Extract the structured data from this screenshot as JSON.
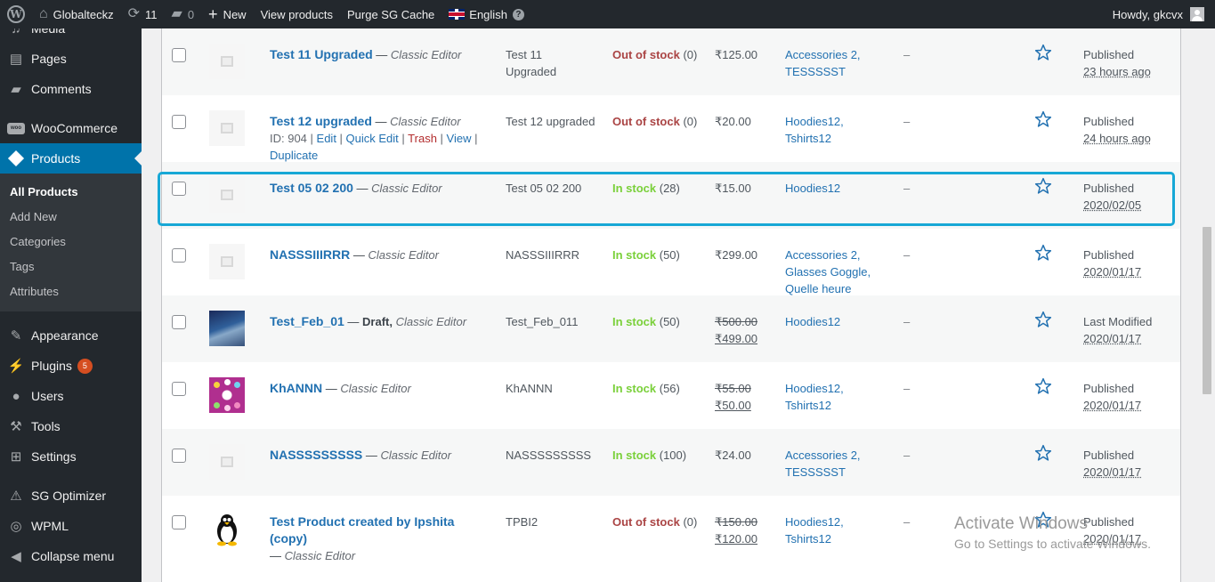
{
  "adminbar": {
    "site_name": "Globalteckz",
    "updates_count": "11",
    "comments_count": "0",
    "new_label": "New",
    "view_products": "View products",
    "purge_cache": "Purge SG Cache",
    "language": "English",
    "howdy": "Howdy, gkcvx"
  },
  "sidebar": {
    "media": "Media",
    "pages": "Pages",
    "comments": "Comments",
    "woocommerce": "WooCommerce",
    "woo_icon_text": "woo",
    "products": "Products",
    "submenu": [
      "All Products",
      "Add New",
      "Categories",
      "Tags",
      "Attributes"
    ],
    "appearance": "Appearance",
    "plugins": "Plugins",
    "plugins_badge": "5",
    "users": "Users",
    "tools": "Tools",
    "settings": "Settings",
    "sg_optimizer": "SG Optimizer",
    "wpml": "WPML",
    "collapse": "Collapse menu"
  },
  "rows": [
    {
      "name": "Test 11 Upgraded",
      "sep": " — ",
      "status": "",
      "editor": "Classic Editor",
      "sku_line1": "Test 11",
      "sku_line2": "Upgraded",
      "stock": "Out of stock",
      "qty": " (0)",
      "price": "₹125.00",
      "price_sale": "",
      "cat1": "Accessories 2,",
      "cat2": "TESSSSST",
      "cat3": "",
      "tags": "–",
      "date_status": "Published",
      "date": "23 hours ago"
    },
    {
      "name": "Test 12 upgraded",
      "sep": " — ",
      "status": "",
      "editor": "Classic Editor",
      "sku_line1": "Test 12 upgraded",
      "sku_line2": "",
      "stock": "Out of stock",
      "qty": " (0)",
      "price": "₹20.00",
      "price_sale": "",
      "cat1": "Hoodies12,",
      "cat2": "Tshirts12",
      "cat3": "",
      "tags": "–",
      "date_status": "Published",
      "date": "24 hours ago",
      "actions": {
        "id": "ID: 904",
        "sep": " | ",
        "edit": "Edit",
        "quick_edit": "Quick Edit",
        "trash": "Trash",
        "view": "View",
        "duplicate": "Duplicate"
      }
    },
    {
      "name": "Test 05 02 200",
      "sep": " — ",
      "status": "",
      "editor": "Classic Editor",
      "sku_line1": "Test 05 02 200",
      "sku_line2": "",
      "stock": "In stock",
      "qty": " (28)",
      "price": "₹15.00",
      "price_sale": "",
      "cat1": "Hoodies12",
      "cat2": "",
      "cat3": "",
      "tags": "–",
      "date_status": "Published",
      "date": "2020/02/05"
    },
    {
      "name": "NASSSIIIRRR",
      "sep": " — ",
      "status": "",
      "editor": "Classic Editor",
      "sku_line1": "NASSSIIIRRR",
      "sku_line2": "",
      "stock": "In stock",
      "qty": " (50)",
      "price": "₹299.00",
      "price_sale": "",
      "cat1": "Accessories 2,",
      "cat2": "Glasses Goggle,",
      "cat3": "Quelle heure",
      "tags": "–",
      "date_status": "Published",
      "date": "2020/01/17"
    },
    {
      "name": "Test_Feb_01",
      "sep": " — ",
      "status": "Draft, ",
      "editor": "Classic Editor",
      "sku_line1": "Test_Feb_011",
      "sku_line2": "",
      "stock": "In stock",
      "qty": " (50)",
      "price": "₹500.00",
      "price_sale": "₹499.00",
      "cat1": "Hoodies12",
      "cat2": "",
      "cat3": "",
      "tags": "–",
      "date_status": "Last Modified",
      "date": "2020/01/17"
    },
    {
      "name": "KhANNN",
      "sep": " — ",
      "status": "",
      "editor": "Classic Editor",
      "sku_line1": "KhANNN",
      "sku_line2": "",
      "stock": "In stock",
      "qty": " (56)",
      "price": "₹55.00",
      "price_sale": "₹50.00",
      "cat1": "Hoodies12,",
      "cat2": "Tshirts12",
      "cat3": "",
      "tags": "–",
      "date_status": "Published",
      "date": "2020/01/17"
    },
    {
      "name": "NASSSSSSSSS",
      "sep": " — ",
      "status": "",
      "editor": "Classic Editor",
      "sku_line1": "NASSSSSSSSS",
      "sku_line2": "",
      "stock": "In stock",
      "qty": " (100)",
      "price": "₹24.00",
      "price_sale": "",
      "cat1": "Accessories 2,",
      "cat2": "TESSSSST",
      "cat3": "",
      "tags": "–",
      "date_status": "Published",
      "date": "2020/01/17"
    },
    {
      "name": "Test Product created by Ipshita (copy)",
      "sep": "— ",
      "status": "",
      "editor": "Classic Editor",
      "sku_line1": "TPBI2",
      "sku_line2": "",
      "stock": "Out of stock",
      "qty": " (0)",
      "price": "₹150.00",
      "price_sale": "₹120.00",
      "cat1": "Hoodies12,",
      "cat2": "Tshirts12",
      "cat3": "",
      "tags": "–",
      "date_status": "Published",
      "date": "2020/01/17"
    }
  ],
  "star_glyph": "☆",
  "watermark": {
    "line1": "Activate Windows",
    "line2": "Go to Settings to activate Windows."
  },
  "colors": {
    "in_stock": "#7ad03a",
    "out_of_stock": "#aa4444",
    "link": "#2271b1",
    "highlight": "#17a8d6",
    "menu_active": "#0073aa"
  }
}
